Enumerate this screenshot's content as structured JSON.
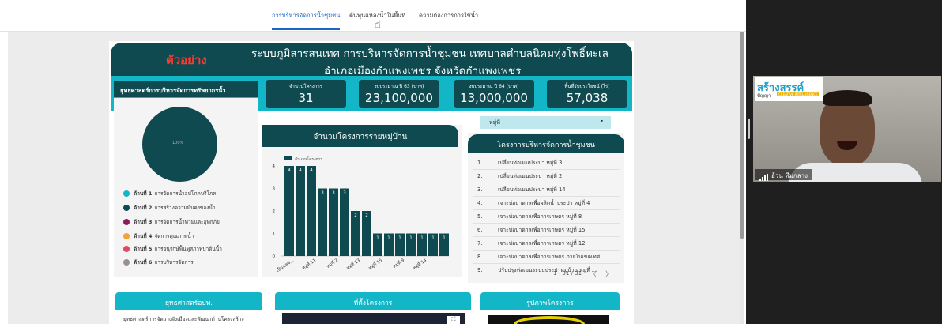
{
  "tabs": [
    "การบริหารจัดการน้ำชุมชน",
    "ต้นทุนแหล่งน้ำในพื้นที่",
    "ความต้องการการใช้น้ำ"
  ],
  "header": {
    "sample_label": "ตัวอย่าง",
    "title_line1": "ระบบภูมิสารสนเทศ การบริหารจัดการน้ำชุมชน เทศบาลตำบลนิคมทุ่งโพธิ์ทะเล",
    "title_line2": "อำเภอเมืองกำแพงเพชร จังหวัดกำแพงเพชร"
  },
  "strategy_panel_title": "ยุทธศาสตร์การบริหารจัดการทรัพยากรน้ำ",
  "kpis": [
    {
      "label": "จำนวนโครงการ",
      "value": "31"
    },
    {
      "label": "งบประมาณ ปี 63 (บาท)",
      "value": "23,100,000"
    },
    {
      "label": "งบประมาณ ปี 64 (บาท)",
      "value": "13,000,000"
    },
    {
      "label": "พื้นที่รับประโยชน์ (ไร่)",
      "value": "57,038"
    }
  ],
  "pie": {
    "label": "100%",
    "value_percent": 100,
    "color": "#0e4a4f"
  },
  "strategies": [
    {
      "key": "ด้านที่ 1",
      "text": "การจัดการน้ำอุปโภคบริโภค",
      "color": "#13b6c6"
    },
    {
      "key": "ด้านที่ 2",
      "text": "การสร้างความมั่นคงของน้ำ",
      "color": "#0e4a4f"
    },
    {
      "key": "ด้านที่ 3",
      "text": "การจัดการน้ำท่วมและอุทกภัย",
      "color": "#8e1a5c"
    },
    {
      "key": "ด้านที่ 4",
      "text": "จัดการคุณภาพน้ำ",
      "color": "#f2a23a"
    },
    {
      "key": "ด้านที่ 5",
      "text": "การอนุรักษ์ฟื้นฟูสภาพป่าต้นน้ำ",
      "color": "#e04a5e"
    },
    {
      "key": "ด้านที่ 6",
      "text": "การบริหารจัดการ",
      "color": "#9a8f8f"
    }
  ],
  "chart_title": "จำนวนโครงการรายหมู่บ้าน",
  "chart_data": {
    "type": "bar",
    "legend": "จำนวนโครงการ",
    "ylim": [
      0,
      4
    ],
    "yticks": [
      "0",
      "1",
      "2",
      "3",
      "4"
    ],
    "values": [
      4,
      4,
      4,
      3,
      3,
      3,
      2,
      2,
      1,
      1,
      1,
      1,
      1,
      1,
      1
    ],
    "xtick_labels": [
      ".เป็นชลซ...",
      "หมู่ที่ 11",
      "หมู่ที่ 2",
      "หมู่ที่ 13",
      "หมู่ที่ 15",
      "หมู่ที่ 9",
      "หมู่ที่ 14"
    ],
    "color": "#0e4a4f"
  },
  "dropdown": {
    "label": "หมู่ที่",
    "arrow": "▾"
  },
  "project_list": {
    "title": "โครงการบริหารจัดการน้ำชุมชน",
    "rows": [
      {
        "n": "1.",
        "text": "เปลี่ยนท่อเมนประปา หมู่ที่ 3"
      },
      {
        "n": "2.",
        "text": "เปลี่ยนท่อเมนประปา หมู่ที่ 2"
      },
      {
        "n": "3.",
        "text": "เปลี่ยนท่อเมนประปา หมู่ที่ 14"
      },
      {
        "n": "4.",
        "text": "เจาะบ่อบาดาลเพื่อผลิตน้ำประปา หมู่ที่ 4"
      },
      {
        "n": "5.",
        "text": "เจาะบ่อบาดาลเพื่อการเกษตร หมู่ที่ 8"
      },
      {
        "n": "6.",
        "text": "เจาะบ่อบาดาลเพื่อการเกษตร หมู่ที่ 15"
      },
      {
        "n": "7.",
        "text": "เจาะบ่อบาดาลเพื่อการเกษตร หมู่ที่ 12"
      },
      {
        "n": "8.",
        "text": "เจาะบ่อบาดาลเพื่อการเกษตร ภายในเขตเทศ..."
      },
      {
        "n": "9.",
        "text": "ปรับปรุงท่อเมนระบบประปาหมู่บ้าน หมู่ที่ ..."
      }
    ],
    "pager": "1 - 31 / 31",
    "prev": "〈",
    "next": "〉"
  },
  "bottom_cards": [
    {
      "title": "ยุทธศาสตร์อปท.",
      "body": "ยุทธศาสตร์การจัดวางผังเมืองและพัฒนาด้านโครงสร้าง"
    },
    {
      "title": "ที่ตั้งโครงการ",
      "expand_icon": "⛶"
    },
    {
      "title": "รูปภาพโครงการ"
    }
  ],
  "webcam": {
    "logo_line1": "สร้างสรรค์",
    "logo_line2": "ปัญญา",
    "logo_tag": "CREATIVE INTELLIGENCE",
    "participant_name": "อ้วน ทีมกลาง"
  }
}
